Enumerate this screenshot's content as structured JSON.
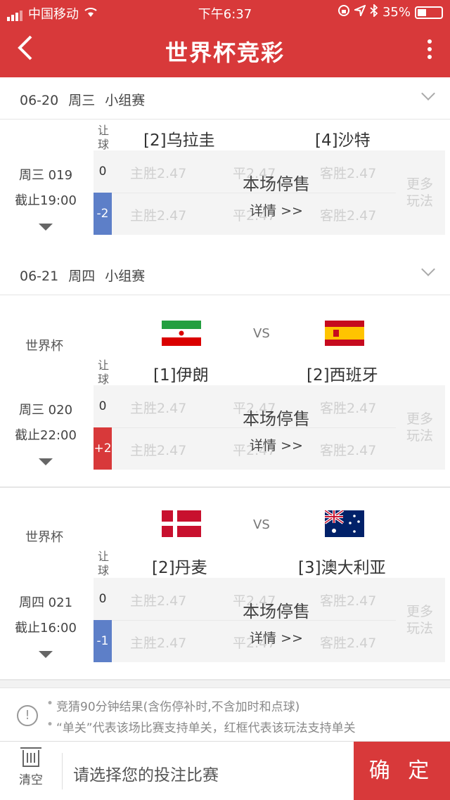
{
  "status_bar": {
    "carrier": "中国移动",
    "time": "下午6:37",
    "battery": "35%"
  },
  "nav": {
    "title": "世界杯竞彩"
  },
  "days": [
    {
      "header": "06-20 周三 小组赛",
      "matches": [
        {
          "league": "",
          "home": "[2]乌拉圭",
          "away": "[4]沙特",
          "code": "周三 019",
          "deadline": "截止19:00",
          "handicap": "-2",
          "handicap_type": "neg"
        }
      ]
    },
    {
      "header": "06-21 周四 小组赛",
      "matches": [
        {
          "league": "世界杯",
          "home": "[1]伊朗",
          "away": "[2]西班牙",
          "code": "周三 020",
          "deadline": "截止22:00",
          "handicap": "+2",
          "handicap_type": "pos"
        },
        {
          "league": "世界杯",
          "home": "[2]丹麦",
          "away": "[3]澳大利亚",
          "code": "周四 021",
          "deadline": "截止16:00",
          "handicap": "-1",
          "handicap_type": "neg"
        }
      ]
    }
  ],
  "common": {
    "rangqiu": "让球",
    "vs": "VS",
    "zero": "0",
    "home_win": "主胜2.47",
    "draw": "平2.47",
    "away_win": "客胜2.47",
    "more": "更多玩法",
    "suspended": "本场停售",
    "details": "详情 >>"
  },
  "notes": [
    "竞猜90分钟结果(含伤停补时,不含加时和点球)",
    "“单关”代表该场比赛支持单关，红框代表该玩法支持单关"
  ],
  "bottom": {
    "clear": "清空",
    "hint": "请选择您的投注比赛",
    "confirm": "确 定"
  },
  "colors": {
    "primary": "#d8393a",
    "handicap_neg": "#5d7fc8",
    "handicap_pos": "#d8393a"
  }
}
